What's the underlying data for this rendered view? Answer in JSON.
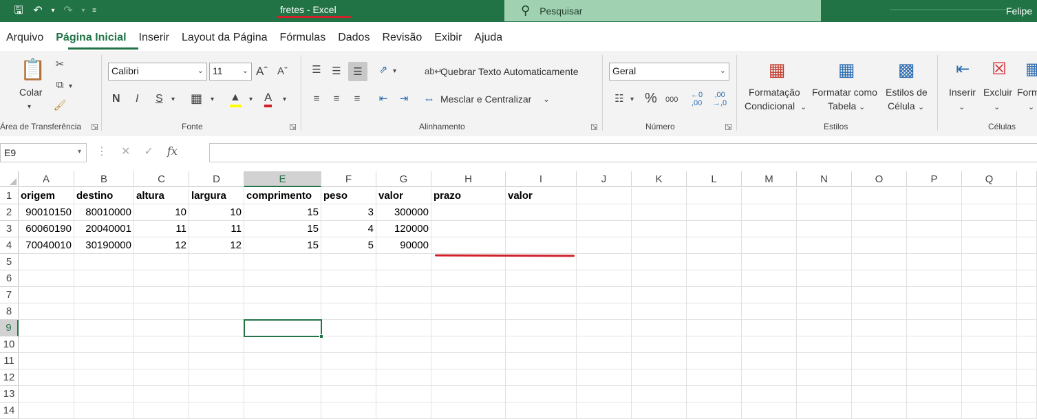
{
  "title_bar": {
    "doc_title": "fretes  -  Excel",
    "search_placeholder": "Pesquisar",
    "user_name": "Felipe",
    "accent": "#217346",
    "quick_access_icons": [
      "save-icon",
      "undo-icon",
      "redo-icon",
      "customize-icon"
    ]
  },
  "tabs": [
    "Arquivo",
    "Página Inicial",
    "Inserir",
    "Layout da Página",
    "Fórmulas",
    "Dados",
    "Revisão",
    "Exibir",
    "Ajuda"
  ],
  "active_tab": "Página Inicial",
  "ribbon": {
    "clipboard": {
      "paste_label": "Colar",
      "group_label": "Área de Transferência"
    },
    "font": {
      "font_name": "Calibri",
      "font_size": "11",
      "bold": "N",
      "italic": "I",
      "underline": "S",
      "group_label": "Fonte"
    },
    "alignment": {
      "wrap_text": "Quebrar Texto Automaticamente",
      "merge_center": "Mesclar e Centralizar",
      "group_label": "Alinhamento"
    },
    "number": {
      "format": "Geral",
      "group_label": "Número"
    },
    "styles": {
      "conditional_1": "Formatação",
      "conditional_2": "Condicional",
      "format_table_1": "Formatar como",
      "format_table_2": "Tabela",
      "cell_styles_1": "Estilos de",
      "cell_styles_2": "Célula",
      "group_label": "Estilos"
    },
    "cells": {
      "insert": "Inserir",
      "delete": "Excluir",
      "format": "Form",
      "group_label": "Células"
    }
  },
  "formula_bar": {
    "name_box": "E9",
    "fx": "fx",
    "content": ""
  },
  "sheet": {
    "columns": [
      "A",
      "B",
      "C",
      "D",
      "E",
      "F",
      "G",
      "H",
      "I",
      "J",
      "K",
      "L",
      "M",
      "N",
      "O",
      "P",
      "Q"
    ],
    "selected_column": "E",
    "selected_row": 9,
    "row_numbers": [
      "1",
      "2",
      "3",
      "4",
      "5",
      "6",
      "7",
      "8",
      "9",
      "10",
      "11",
      "12",
      "13",
      "14"
    ],
    "headers": [
      "origem",
      "destino",
      "altura",
      "largura",
      "comprimento",
      "peso",
      "valor",
      "prazo",
      "valor"
    ],
    "rows": [
      [
        "90010150",
        "80010000",
        "10",
        "10",
        "15",
        "3",
        "300000"
      ],
      [
        "60060190",
        "20040001",
        "11",
        "11",
        "15",
        "4",
        "120000"
      ],
      [
        "70040010",
        "30190000",
        "12",
        "12",
        "15",
        "5",
        "90000"
      ]
    ]
  }
}
